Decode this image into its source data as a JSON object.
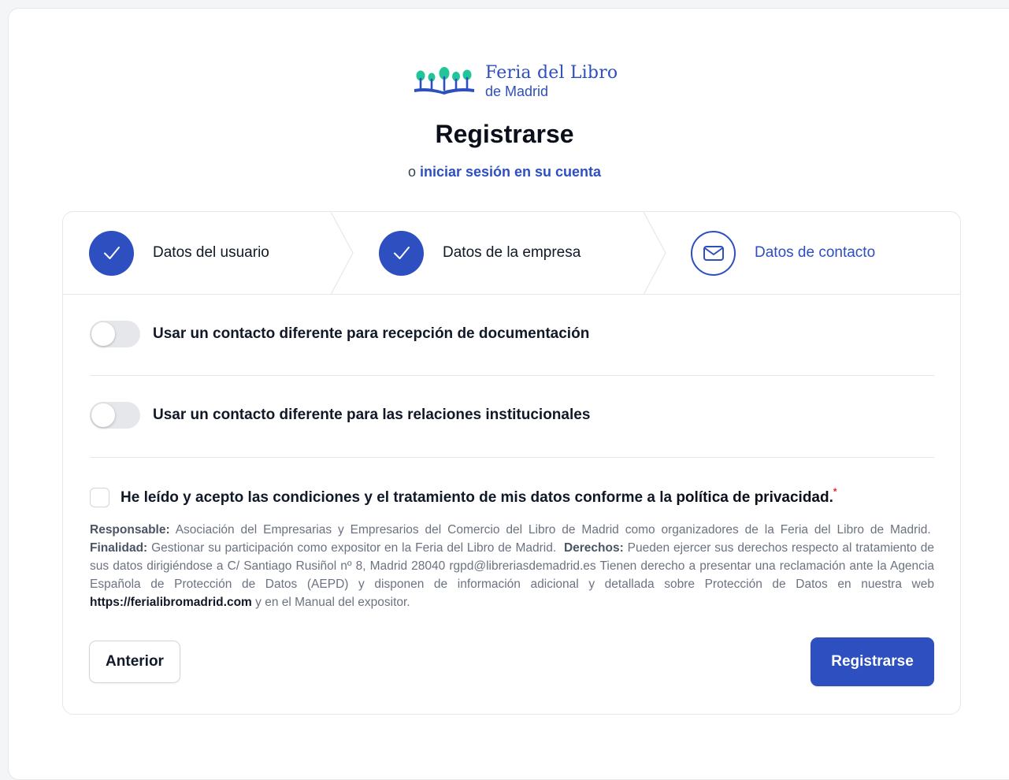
{
  "brand": {
    "line1": "Feria del Libro",
    "line2": "de Madrid",
    "color": "#2d4fbf",
    "accent_green": "#22c59a"
  },
  "header": {
    "title": "Registrarse",
    "login_prefix": "o",
    "login_link": "iniciar sesión en su cuenta"
  },
  "steps": [
    {
      "label": "Datos del usuario",
      "status": "completed",
      "icon": "check-icon"
    },
    {
      "label": "Datos de la empresa",
      "status": "completed",
      "icon": "check-icon"
    },
    {
      "label": "Datos de contacto",
      "status": "current",
      "icon": "mail-icon"
    }
  ],
  "toggles": [
    {
      "label": "Usar un contacto diferente para recepción de documentación",
      "checked": false
    },
    {
      "label": "Usar un contacto diferente para las relaciones institucionales",
      "checked": false
    }
  ],
  "consent": {
    "checked": false,
    "text": "He leído y acepto las condiciones y el tratamiento de mis datos conforme a la",
    "link": "política de privacidad",
    "period": ".",
    "required_mark": "*"
  },
  "legal": {
    "responsable_label": "Responsable:",
    "responsable_text": "Asociación del Empresarias y Empresarios del Comercio del Libro de Madrid como organizadores de la Feria del Libro de Madrid.",
    "finalidad_label": "Finalidad:",
    "finalidad_text": "Gestionar su participación como expositor en la Feria del Libro de Madrid.",
    "derechos_label": "Derechos:",
    "derechos_text": "Pueden ejercer sus derechos respecto al tratamiento de sus datos dirigiéndose a C/ Santiago Rusiñol nº 8, Madrid 28040 rgpd@libreriasdemadrid.es Tienen derecho a presentar una reclamación ante la Agencia Española de Protección de Datos (AEPD) y disponen de información adicional y detallada sobre Protección de Datos en nuestra web",
    "web": "https://ferialibromadrid.com",
    "tail": "y en el Manual del expositor."
  },
  "actions": {
    "previous": "Anterior",
    "submit": "Registrarse"
  }
}
